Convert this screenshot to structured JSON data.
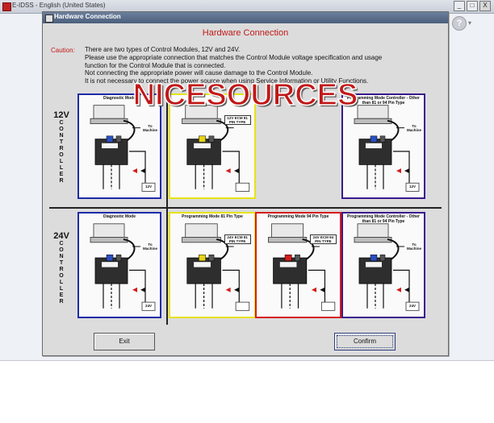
{
  "app": {
    "title": "E-IDSS - English (United States)",
    "window_buttons": {
      "minimize": "_",
      "maximize": "□",
      "close": "X"
    },
    "help": "?"
  },
  "dialog": {
    "title": "Hardware Connection",
    "heading": "Hardware Connection",
    "caution_label": "Caution:",
    "caution_lines": [
      "There are two types of Control Modules, 12V and 24V.",
      "Please use the appropriate connection that matches the Control Module voltage specification and usage",
      "function for the Control Module that is connected.",
      "Not connecting the appropriate power will cause damage to the Control Module.",
      "It is not necessary to connect the power source when using Service Information or Utility Functions."
    ],
    "watermark": "NICESOURCES",
    "rows": [
      {
        "volt": "12V",
        "controller": "CONTROLLER"
      },
      {
        "volt": "24V",
        "controller": "CONTROLLER"
      }
    ],
    "panels": [
      {
        "title": "Diagnostic Mode",
        "battery": "12V",
        "to_machine": "To Machine",
        "color": "#1f2aa8"
      },
      {
        "title": "",
        "ecm_tag": "12V ECM 81 PIN TYPE",
        "color": "#e6e21a"
      },
      {
        "title": "Programming Mode Controller - Other than 81 or 94 Pin Type",
        "battery": "12V",
        "to_machine": "To Machine",
        "color": "#3a1a8c"
      },
      {
        "title": "Diagnostic Mode",
        "battery": "24V",
        "to_machine": "To Machine",
        "color": "#1f2aa8"
      },
      {
        "title": "Programming Mode  81 Pin Type",
        "ecm_tag": "24V ECM 81 PIN TYPE",
        "color": "#e6e21a"
      },
      {
        "title": "Programming Mode  94 Pin Type",
        "ecm_tag": "24V ECM 94 PIN TYPE",
        "color": "#d41c1c"
      },
      {
        "title": "Programming Mode Controller - Other than 81 or 94 Pin Type",
        "battery": "24V",
        "to_machine": "To Machine",
        "color": "#3a1a8c"
      }
    ],
    "exit_label": "Exit",
    "confirm_label": "Confirm"
  }
}
